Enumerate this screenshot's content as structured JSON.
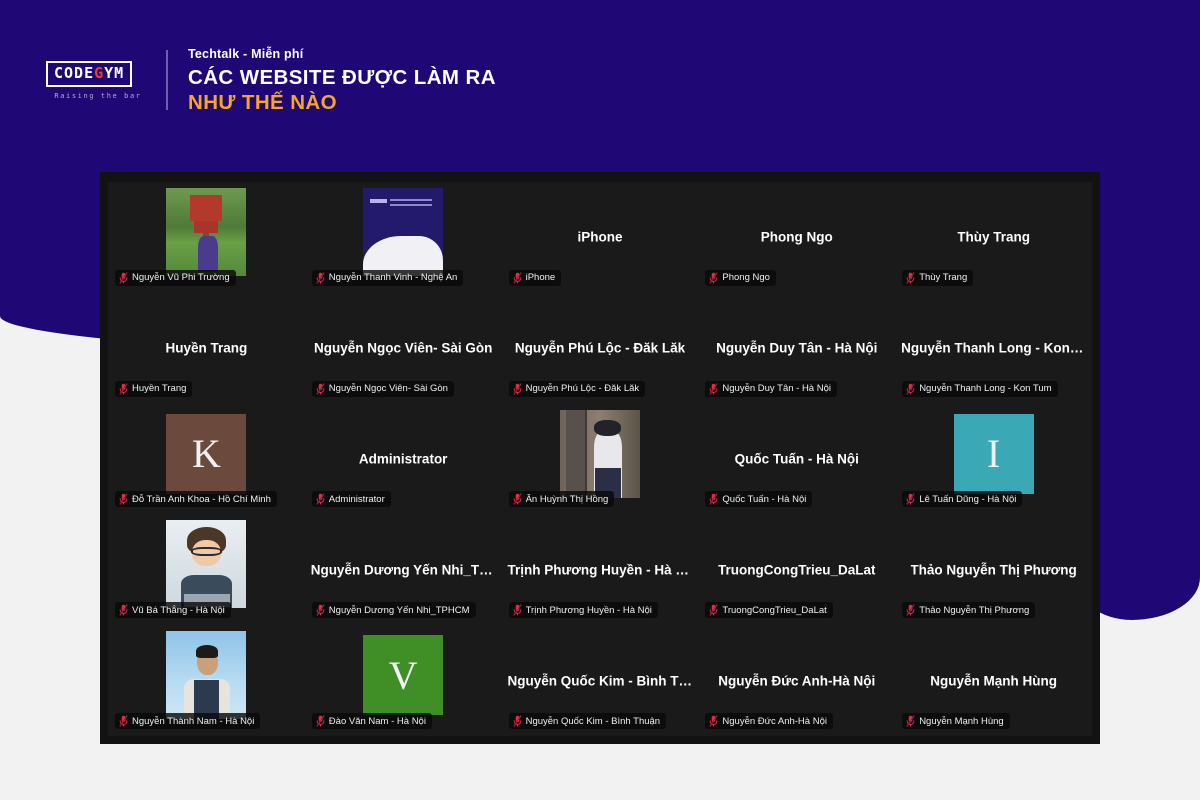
{
  "header": {
    "logo": {
      "word_part1": "CODE",
      "word_accent": "G",
      "word_part2": "YM",
      "tagline": "Raising the bar"
    },
    "eyebrow": "Techtalk - Miễn phí",
    "title_line1": "CÁC WEBSITE ĐƯỢC LÀM RA",
    "title_line2": "NHƯ THẾ NÀO"
  },
  "colors": {
    "brand_purple": "#1f0875",
    "accent_gold": "#f6a623",
    "logo_accent_red": "#e8402a",
    "zoom_window_bg": "#121212",
    "tile_bg": "#1a1a1a",
    "mic_muted_red": "#e02b4a",
    "avatar_k": "#6b4a3d",
    "avatar_i": "#3ba8b5",
    "avatar_v": "#3f8f26"
  },
  "meeting": {
    "grid_columns": 5,
    "grid_rows": 5,
    "tiles": [
      {
        "big_name": "",
        "badge_name": "Nguyễn Vũ Phi Trường",
        "muted": true,
        "media": "video-park",
        "media_kind": "video"
      },
      {
        "big_name": "",
        "badge_name": "Nguyễn Thanh Vinh - Nghệ An",
        "muted": true,
        "media": "video-slide",
        "media_kind": "video"
      },
      {
        "big_name": "iPhone",
        "badge_name": "iPhone",
        "muted": true,
        "media": "",
        "media_kind": "none"
      },
      {
        "big_name": "Phong Ngo",
        "badge_name": "Phong Ngo",
        "muted": true,
        "media": "",
        "media_kind": "none"
      },
      {
        "big_name": "Thùy Trang",
        "badge_name": "Thùy Trang",
        "muted": true,
        "media": "",
        "media_kind": "none"
      },
      {
        "big_name": "Huyền Trang",
        "badge_name": "Huyền Trang",
        "muted": true,
        "media": "",
        "media_kind": "none"
      },
      {
        "big_name": "Nguyễn Ngọc Viên- Sài Gòn",
        "badge_name": "Nguyễn Ngọc Viên- Sài Gòn",
        "muted": true,
        "media": "",
        "media_kind": "none"
      },
      {
        "big_name": "Nguyễn Phú Lộc - Đăk Lăk",
        "badge_name": "Nguyễn Phú Lộc - Đăk Lăk",
        "muted": true,
        "media": "",
        "media_kind": "none"
      },
      {
        "big_name": "Nguyễn Duy Tân - Hà Nội",
        "badge_name": "Nguyễn Duy Tân - Hà Nội",
        "muted": true,
        "media": "",
        "media_kind": "none"
      },
      {
        "big_name": "Nguyễn Thanh Long - Kon T...",
        "badge_name": "Nguyễn Thanh Long - Kon Tum",
        "muted": true,
        "media": "",
        "media_kind": "none"
      },
      {
        "big_name": "",
        "badge_name": "Đỗ Trần Anh Khoa - Hồ Chí Minh",
        "muted": true,
        "media": "K",
        "media_kind": "letter",
        "media_color": "#6b4a3d"
      },
      {
        "big_name": "Administrator",
        "badge_name": "Administrator",
        "muted": true,
        "media": "",
        "media_kind": "none"
      },
      {
        "big_name": "",
        "badge_name": "Ân Huỳnh Thị Hồng",
        "muted": true,
        "media": "video-girl",
        "media_kind": "video"
      },
      {
        "big_name": "Quốc Tuấn - Hà Nội",
        "badge_name": "Quốc Tuấn - Hà Nội",
        "muted": true,
        "media": "",
        "media_kind": "none"
      },
      {
        "big_name": "",
        "badge_name": "Lê Tuấn Dũng - Hà Nội",
        "muted": true,
        "media": "I",
        "media_kind": "letter",
        "media_color": "#3ba8b5"
      },
      {
        "big_name": "",
        "badge_name": "Vũ Bá Thắng - Hà Nội",
        "muted": true,
        "media": "video-avatar3d",
        "media_kind": "video"
      },
      {
        "big_name": "Nguyễn Dương Yến Nhi_TP...",
        "badge_name": "Nguyễn Dương Yến Nhi_TPHCM",
        "muted": true,
        "media": "",
        "media_kind": "none"
      },
      {
        "big_name": "Trịnh Phương Huyền - Hà Nội",
        "badge_name": "Trịnh Phương Huyền - Hà Nội",
        "muted": true,
        "media": "",
        "media_kind": "none"
      },
      {
        "big_name": "TruongCongTrieu_DaLat",
        "badge_name": "TruongCongTrieu_DaLat",
        "muted": true,
        "media": "",
        "media_kind": "none"
      },
      {
        "big_name": "Thảo Nguyễn Thị Phương",
        "badge_name": "Thảo Nguyễn Thị Phương",
        "muted": true,
        "media": "",
        "media_kind": "none"
      },
      {
        "big_name": "",
        "badge_name": "Nguyễn Thành Nam - Hà Nội",
        "muted": true,
        "media": "video-man",
        "media_kind": "video"
      },
      {
        "big_name": "",
        "badge_name": "Đào Văn Nam - Hà Nội",
        "muted": true,
        "media": "V",
        "media_kind": "letter",
        "media_color": "#3f8f26"
      },
      {
        "big_name": "Nguyễn Quốc Kim - Bình Th...",
        "badge_name": "Nguyễn Quốc Kim - Bình Thuận",
        "muted": true,
        "media": "",
        "media_kind": "none"
      },
      {
        "big_name": "Nguyễn Đức Anh-Hà Nội",
        "badge_name": "Nguyễn Đức Anh-Hà Nội",
        "muted": true,
        "media": "",
        "media_kind": "none"
      },
      {
        "big_name": "Nguyễn Mạnh Hùng",
        "badge_name": "Nguyễn Mạnh Hùng",
        "muted": true,
        "media": "",
        "media_kind": "none"
      }
    ]
  }
}
